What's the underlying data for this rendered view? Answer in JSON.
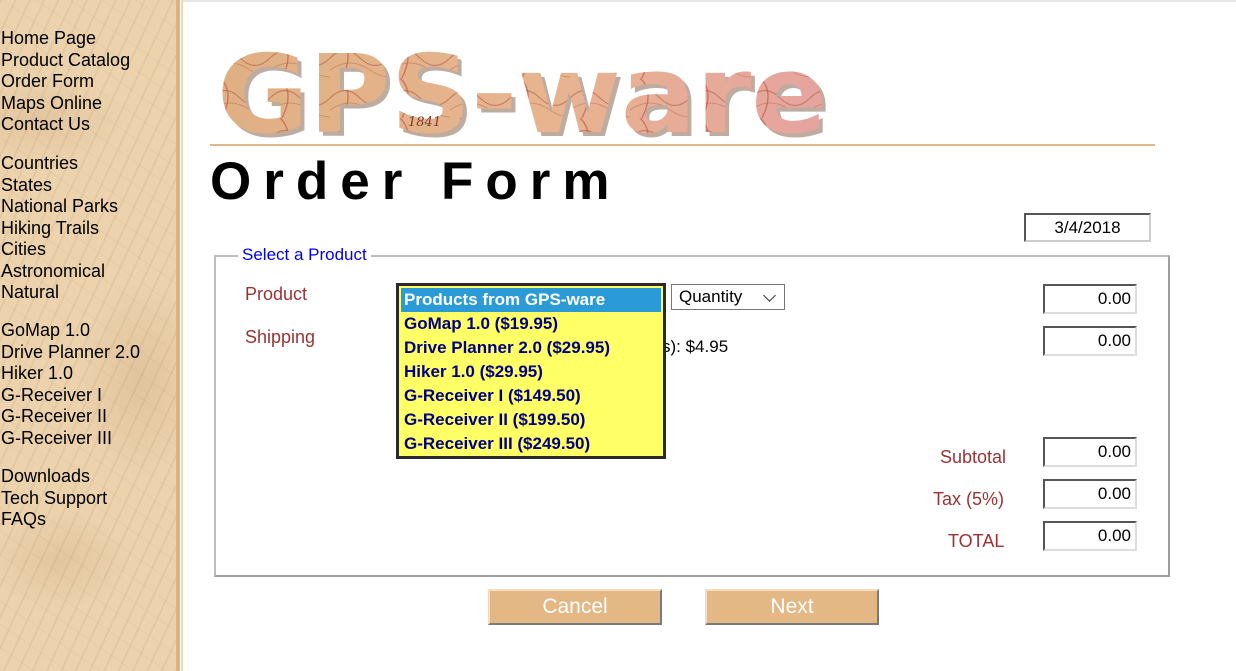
{
  "sidebar": {
    "group1": [
      "Home Page",
      "Product Catalog",
      "Order Form",
      "Maps Online",
      "Contact Us"
    ],
    "group2": [
      "Countries",
      "States",
      "National Parks",
      "Hiking Trails",
      "Cities",
      "Astronomical",
      "Natural"
    ],
    "group3": [
      "GoMap 1.0",
      "Drive Planner 2.0",
      "Hiker 1.0",
      "G-Receiver I",
      "G-Receiver II",
      "G-Receiver III"
    ],
    "group4": [
      "Downloads",
      "Tech Support",
      "FAQs"
    ]
  },
  "logo": {
    "text": "GPS-ware",
    "year": "1841"
  },
  "page_title": "Order Form",
  "date": "3/4/2018",
  "form": {
    "legend": "Select a Product",
    "product_label": "Product",
    "shipping_label": "Shipping",
    "shipping_text": "s): $4.95",
    "product_options": [
      "Products from GPS-ware",
      "GoMap 1.0 ($19.95)",
      "Drive Planner 2.0 ($29.95)",
      "Hiker 1.0 ($29.95)",
      "G-Receiver I ($149.50)",
      "G-Receiver II ($199.50)",
      "G-Receiver III ($249.50)"
    ],
    "quantity_label": "Quantity",
    "product_cost": "0.00",
    "shipping_cost": "0.00",
    "subtotal_label": "Subtotal",
    "subtotal": "0.00",
    "tax_label": "Tax (5%)",
    "tax": "0.00",
    "total_label": "TOTAL",
    "total": "0.00"
  },
  "buttons": {
    "cancel": "Cancel",
    "next": "Next"
  },
  "colors": {
    "sidebar_bg": "#ecd3ad",
    "label": "#993333",
    "legend": "#0000ee",
    "option_text": "#000080",
    "list_bg": "#ffff66",
    "selected_bg": "#2b9bd8",
    "button_bg": "#e3b885"
  }
}
